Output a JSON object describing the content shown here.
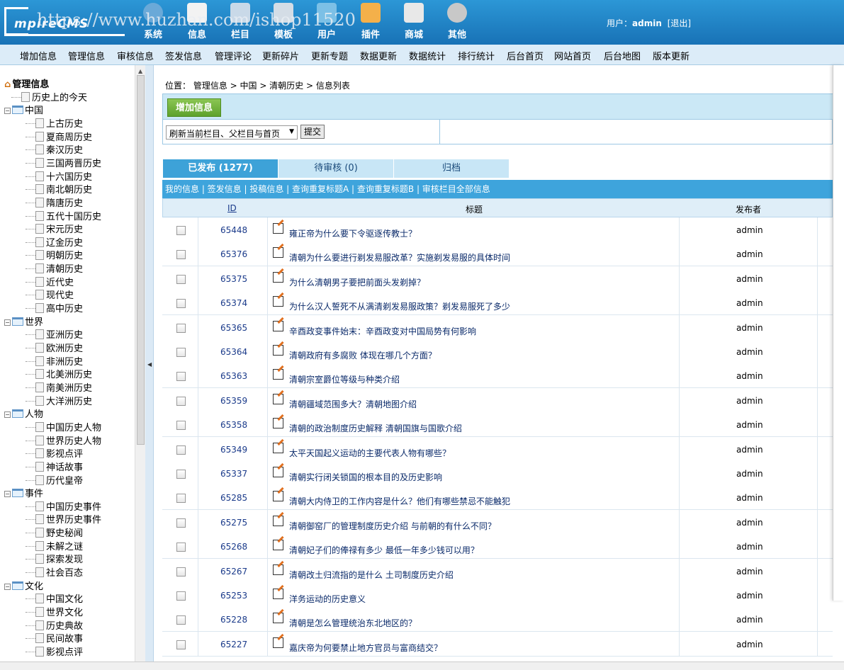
{
  "watermark": "https://www.huzhan.com/ishop11520",
  "logo_text": "mpireCMS",
  "top_nav": [
    {
      "label": "系统",
      "icon": "globe-icon"
    },
    {
      "label": "信息",
      "icon": "document-edit-icon"
    },
    {
      "label": "栏目",
      "icon": "folder-icon"
    },
    {
      "label": "模板",
      "icon": "template-icon"
    },
    {
      "label": "用户",
      "icon": "user-icon"
    },
    {
      "label": "插件",
      "icon": "tools-icon"
    },
    {
      "label": "商城",
      "icon": "shop-card-icon"
    },
    {
      "label": "其他",
      "icon": "gear-icon"
    }
  ],
  "user": {
    "prefix": "用户：",
    "name": "admin",
    "logout": "[退出]"
  },
  "menu": [
    "增加信息",
    "管理信息",
    "审核信息",
    "签发信息",
    "管理评论",
    "更新碎片",
    "更新专题",
    "数据更新",
    "数据统计",
    "排行统计",
    "后台首页",
    "网站首页",
    "后台地图",
    "版本更新"
  ],
  "tree": {
    "root": "管理信息",
    "nodes": [
      {
        "label": "历史上的今天",
        "level": 1,
        "type": "page"
      },
      {
        "label": "中国",
        "level": 0,
        "type": "folder"
      },
      {
        "label": "上古历史",
        "level": 2,
        "type": "page"
      },
      {
        "label": "夏商周历史",
        "level": 2,
        "type": "page"
      },
      {
        "label": "秦汉历史",
        "level": 2,
        "type": "page"
      },
      {
        "label": "三国两晋历史",
        "level": 2,
        "type": "page"
      },
      {
        "label": "十六国历史",
        "level": 2,
        "type": "page"
      },
      {
        "label": "南北朝历史",
        "level": 2,
        "type": "page"
      },
      {
        "label": "隋唐历史",
        "level": 2,
        "type": "page"
      },
      {
        "label": "五代十国历史",
        "level": 2,
        "type": "page"
      },
      {
        "label": "宋元历史",
        "level": 2,
        "type": "page"
      },
      {
        "label": "辽金历史",
        "level": 2,
        "type": "page"
      },
      {
        "label": "明朝历史",
        "level": 2,
        "type": "page"
      },
      {
        "label": "清朝历史",
        "level": 2,
        "type": "page"
      },
      {
        "label": "近代史",
        "level": 2,
        "type": "page"
      },
      {
        "label": "现代史",
        "level": 2,
        "type": "page"
      },
      {
        "label": "高中历史",
        "level": 2,
        "type": "page"
      },
      {
        "label": "世界",
        "level": 0,
        "type": "folder"
      },
      {
        "label": "亚洲历史",
        "level": 2,
        "type": "page"
      },
      {
        "label": "欧洲历史",
        "level": 2,
        "type": "page"
      },
      {
        "label": "非洲历史",
        "level": 2,
        "type": "page"
      },
      {
        "label": "北美洲历史",
        "level": 2,
        "type": "page"
      },
      {
        "label": "南美洲历史",
        "level": 2,
        "type": "page"
      },
      {
        "label": "大洋洲历史",
        "level": 2,
        "type": "page"
      },
      {
        "label": "人物",
        "level": 0,
        "type": "folder"
      },
      {
        "label": "中国历史人物",
        "level": 2,
        "type": "page"
      },
      {
        "label": "世界历史人物",
        "level": 2,
        "type": "page"
      },
      {
        "label": "影视点评",
        "level": 2,
        "type": "page"
      },
      {
        "label": "神话故事",
        "level": 2,
        "type": "page"
      },
      {
        "label": "历代皇帝",
        "level": 2,
        "type": "page"
      },
      {
        "label": "事件",
        "level": 0,
        "type": "folder"
      },
      {
        "label": "中国历史事件",
        "level": 2,
        "type": "page"
      },
      {
        "label": "世界历史事件",
        "level": 2,
        "type": "page"
      },
      {
        "label": "野史秘闻",
        "level": 2,
        "type": "page"
      },
      {
        "label": "未解之谜",
        "level": 2,
        "type": "page"
      },
      {
        "label": "探索发现",
        "level": 2,
        "type": "page"
      },
      {
        "label": "社会百态",
        "level": 2,
        "type": "page"
      },
      {
        "label": "文化",
        "level": 0,
        "type": "folder"
      },
      {
        "label": "中国文化",
        "level": 2,
        "type": "page"
      },
      {
        "label": "世界文化",
        "level": 2,
        "type": "page"
      },
      {
        "label": "历史典故",
        "level": 2,
        "type": "page"
      },
      {
        "label": "民间故事",
        "level": 2,
        "type": "page"
      },
      {
        "label": "影视点评",
        "level": 2,
        "type": "page"
      }
    ]
  },
  "breadcrumb": "位置： 管理信息 > 中国 > 清朝历史 > 信息列表",
  "add_button": "增加信息",
  "refresh_select": "刷新当前栏目、父栏目与首页",
  "submit_button": "提交",
  "tabs": [
    {
      "label": "已发布 (1277)",
      "active": true
    },
    {
      "label": "待审核 (0)",
      "active": false
    },
    {
      "label": "归档",
      "active": false
    }
  ],
  "subnav": "我的信息 | 签发信息 | 投稿信息 | 查询重复标题A | 查询重复标题B | 审核栏目全部信息",
  "columns": {
    "id": "ID",
    "title": "标题",
    "author": "发布者"
  },
  "rows": [
    {
      "id": "65448",
      "title": "雍正帝为什么要下令驱逐传教士？",
      "author": "admin"
    },
    {
      "id": "65376",
      "title": "清朝为什么要进行剃发易服改革？实施剃发易服的具体时间",
      "author": "admin"
    },
    {
      "id": "65375",
      "title": "为什么清朝男子要把前面头发剃掉？",
      "author": "admin"
    },
    {
      "id": "65374",
      "title": "为什么汉人誓死不从满清剃发易服政策？剃发易服死了多少",
      "author": "admin"
    },
    {
      "id": "65365",
      "title": "辛酉政变事件始末：辛酉政变对中国局势有何影响",
      "author": "admin"
    },
    {
      "id": "65364",
      "title": "清朝政府有多腐败 体现在哪几个方面？",
      "author": "admin"
    },
    {
      "id": "65363",
      "title": "清朝宗室爵位等级与种类介绍",
      "author": "admin"
    },
    {
      "id": "65359",
      "title": "清朝疆域范围多大？清朝地图介绍",
      "author": "admin"
    },
    {
      "id": "65358",
      "title": "清朝的政治制度历史解释 清朝国旗与国歌介绍",
      "author": "admin"
    },
    {
      "id": "65349",
      "title": "太平天国起义运动的主要代表人物有哪些？",
      "author": "admin"
    },
    {
      "id": "65337",
      "title": "清朝实行闭关锁国的根本目的及历史影响",
      "author": "admin"
    },
    {
      "id": "65285",
      "title": "清朝大内侍卫的工作内容是什么？他们有哪些禁忌不能触犯",
      "author": "admin"
    },
    {
      "id": "65275",
      "title": "清朝御窑厂的管理制度历史介绍 与前朝的有什么不同？",
      "author": "admin"
    },
    {
      "id": "65268",
      "title": "清朝妃子们的俸禄有多少 最低一年多少钱可以用？",
      "author": "admin"
    },
    {
      "id": "65267",
      "title": "清朝改土归流指的是什么 土司制度历史介绍",
      "author": "admin"
    },
    {
      "id": "65253",
      "title": "洋务运动的历史意义",
      "author": "admin"
    },
    {
      "id": "65228",
      "title": "清朝是怎么管理统治东北地区的？",
      "author": "admin"
    },
    {
      "id": "65227",
      "title": "嘉庆帝为何要禁止地方官员与富商结交？",
      "author": "admin"
    }
  ],
  "colors": {
    "topbar": "#1c83c6",
    "menubar": "#dcecf8",
    "tab_active": "#3da2d8",
    "add_button": "#6cb33a"
  }
}
